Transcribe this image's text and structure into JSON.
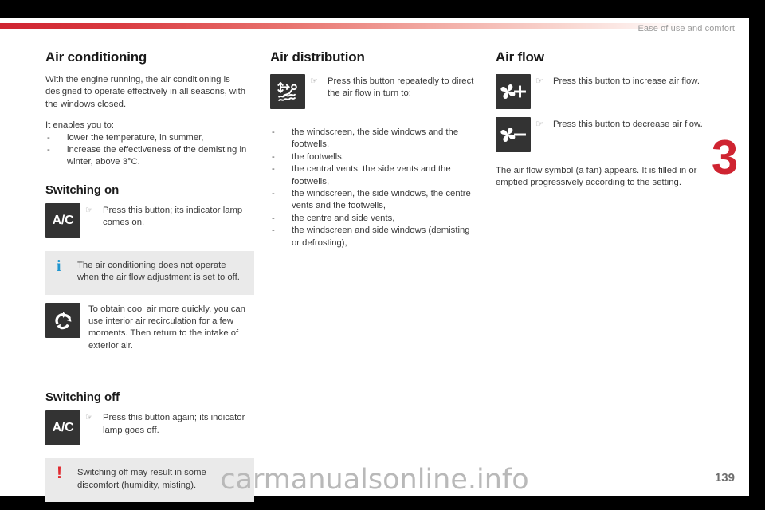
{
  "header": {
    "running_head": "Ease of use and comfort",
    "chapter_number": "3",
    "page_number": "139",
    "watermark": "carmanualsonline.info"
  },
  "colors": {
    "accent_red": "#cf2431",
    "info_blue": "#2196cf",
    "warning_red": "#e02a30",
    "button_dark": "#333333",
    "callout_bg": "#eaeaea"
  },
  "glyphs": {
    "hand": "☞",
    "dash": "-",
    "info": "i",
    "warning": "!"
  },
  "left_column": {
    "title": "Air conditioning",
    "intro": "With the engine running, the air conditioning is designed to operate effectively in all seasons, with the windows closed.",
    "enables_lead": "It enables you to:",
    "enables_items": [
      "lower the temperature, in summer,",
      "increase the effectiveness of the demisting in winter, above 3°C."
    ],
    "switching_on_title": "Switching on",
    "switching_on_button_label": "A/C",
    "switching_on_caption": "Press this button; its indicator lamp comes on.",
    "info_callout": "The air conditioning does not operate when the air flow adjustment is set to off.",
    "recirculation_note": "To obtain cool air more quickly, you can use interior air recirculation for a few moments. Then return to the intake of exterior air.",
    "recirculation_icon_name": "air-recirculation-icon",
    "switching_off_title": "Switching off",
    "switching_off_button_label": "A/C",
    "switching_off_caption": "Press this button again; its indicator lamp goes off.",
    "warning_callout": "Switching off may result in some discomfort (humidity, misting)."
  },
  "middle_column": {
    "title": "Air distribution",
    "button_icon_name": "air-distribution-icon",
    "button_caption": "Press this button repeatedly to direct the air flow in turn to:",
    "destinations": [
      "the windscreen, the side windows and the footwells,",
      "the footwells.",
      "the central vents, the side vents and the footwells,",
      "the windscreen, the side windows, the centre vents and the footwells,",
      "the centre and side vents,",
      "the windscreen and side windows (demisting or defrosting),"
    ]
  },
  "right_column": {
    "title": "Air flow",
    "increase_icon_name": "fan-plus-icon",
    "increase_caption": "Press this button to increase air flow.",
    "decrease_icon_name": "fan-minus-icon",
    "decrease_caption": "Press this button to decrease air flow.",
    "closing_paragraph": "The air flow symbol (a fan) appears. It is filled in or emptied progressively according to the setting."
  }
}
